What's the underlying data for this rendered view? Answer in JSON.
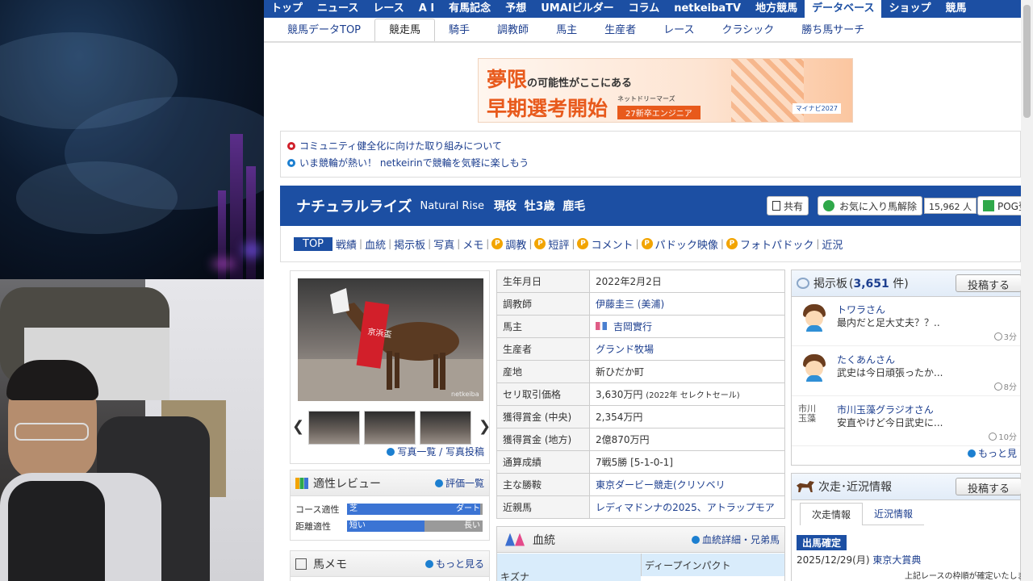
{
  "global_nav": [
    "トップ",
    "ニュース",
    "レース",
    "A I",
    "有馬記念",
    "予想",
    "UMAIビルダー",
    "コラム",
    "netkeibaTV",
    "地方競馬",
    "データベース",
    "ショップ",
    "競馬"
  ],
  "global_nav_active": "データベース",
  "sub_nav": [
    "競馬データTOP",
    "競走馬",
    "騎手",
    "調教師",
    "馬主",
    "生産者",
    "レース",
    "クラシック",
    "勝ち馬サーチ"
  ],
  "sub_nav_active": "競走馬",
  "banner": {
    "line1": "夢限",
    "line1_small": "の可能性がここにある",
    "line2": "早期選考開始",
    "sub1": "ネットドリーマーズ",
    "sub2": "27新卒エンジニア",
    "brand": "マイナビ2027"
  },
  "notices": [
    {
      "text": "コミュニティ健全化に向けた取り組みについて",
      "color": "#d0202a"
    },
    {
      "text": "いま競輪が熱い！ netkeirinで競輪を気軽に楽しもう",
      "color": "#1c7fd0"
    }
  ],
  "horse": {
    "name": "ナチュラルライズ",
    "name_en": "Natural Rise",
    "info": "現役  牡3歳  鹿毛",
    "share_label": "共有",
    "fav_label": "お気に入り馬解除",
    "fav_count": "15,962 人",
    "pog_label": "POG登"
  },
  "tabs": [
    {
      "label": "TOP",
      "p": false
    },
    {
      "label": "戦績",
      "p": false
    },
    {
      "label": "血統",
      "p": false
    },
    {
      "label": "掲示板",
      "p": false
    },
    {
      "label": "写真",
      "p": false
    },
    {
      "label": "メモ",
      "p": false
    },
    {
      "label": "調教",
      "p": true
    },
    {
      "label": "短評",
      "p": true
    },
    {
      "label": "コメント",
      "p": true
    },
    {
      "label": "パドック映像",
      "p": true
    },
    {
      "label": "フォトパドック",
      "p": true
    },
    {
      "label": "近況",
      "p": false
    }
  ],
  "photo": {
    "caption": "netkeiba",
    "links": "写真一覧 / 写真投稿"
  },
  "review": {
    "title": "適性レビュー",
    "link": "評価一覧",
    "rows": [
      {
        "label": "コース適性",
        "left": "芝",
        "right": "ダート",
        "value": 0.98
      },
      {
        "label": "距離適性",
        "left": "短い",
        "right": "長い",
        "value": 0.57
      }
    ]
  },
  "memo": {
    "title": "馬メモ",
    "link": "もっと見る"
  },
  "profile": [
    {
      "label": "生年月日",
      "value": "2022年2月2日",
      "link": false
    },
    {
      "label": "調教師",
      "value": "伊藤圭三 (美浦)",
      "link": true
    },
    {
      "label": "馬主",
      "value": "吉岡實行",
      "link": true,
      "owner_icon": true
    },
    {
      "label": "生産者",
      "value": "グランド牧場",
      "link": true
    },
    {
      "label": "産地",
      "value": "新ひだか町",
      "link": false
    },
    {
      "label": "セリ取引価格",
      "value": "3,630万円",
      "value_small": "(2022年 セレクトセール)",
      "link": false
    },
    {
      "label": "獲得賞金 (中央)",
      "value": "2,354万円",
      "link": false
    },
    {
      "label": "獲得賞金 (地方)",
      "value": "2億870万円",
      "link": false
    },
    {
      "label": "通算成績",
      "value": "7戦5勝 [5-1-0-1]",
      "link": false
    },
    {
      "label": "主な勝鞍",
      "value": "東京ダービー競走(クリソベリ",
      "link": true
    },
    {
      "label": "近親馬",
      "value": "レディマドンナの2025、アトラップモア",
      "link": true
    }
  ],
  "bloodline": {
    "title": "血統",
    "link": "血統詳細・兄弟馬",
    "father": "ディープインパクト",
    "horse": "キズナ"
  },
  "bbs": {
    "title": "掲示板",
    "count": "3,651",
    "count_suffix": "件",
    "post_label": "投稿する",
    "more": "もっと見",
    "items": [
      {
        "user": "トワラさん",
        "text": "最内だと足大丈夫？？..",
        "time": "3分"
      },
      {
        "user": "たくあんさん",
        "text": "武史は今日頑張ったか...",
        "time": "8分"
      },
      {
        "user": "市川玉藻グラジオさん",
        "text": "安直やけど今日武史に...",
        "time": "10分",
        "img_alt": "市川玉藻"
      }
    ]
  },
  "next": {
    "title": "次走･近況情報",
    "post_label": "投稿する",
    "tab1": "次走情報",
    "tab2": "近況情報",
    "badge": "出馬確定",
    "date": "2025/12/29(月)",
    "race": "東京大賞典",
    "note": "上記レースの枠順が確定いたしま"
  }
}
